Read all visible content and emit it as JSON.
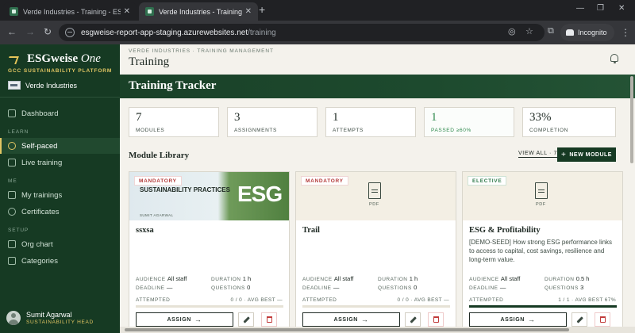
{
  "browser": {
    "tabs": [
      {
        "title": "Verde Industries - Training - ESG",
        "active": false
      },
      {
        "title": "Verde Industries - Training - ESG",
        "active": true
      }
    ],
    "url_host": "esgweise-report-app-staging.azurewebsites.net",
    "url_path": "/training",
    "incognito_label": "Incognito"
  },
  "sidebar": {
    "brand": "ESGweise",
    "brand_suffix": "One",
    "platform": "GCC SUSTAINABILITY PLATFORM",
    "org": "Verde Industries",
    "items": [
      {
        "label": "Dashboard",
        "icon": "grid-icon"
      },
      {
        "section": "LEARN"
      },
      {
        "label": "Self-paced",
        "icon": "play-circle-icon",
        "active": true
      },
      {
        "label": "Live training",
        "icon": "video-icon"
      },
      {
        "section": "ME"
      },
      {
        "label": "My trainings",
        "icon": "book-icon"
      },
      {
        "label": "Certificates",
        "icon": "award-icon"
      },
      {
        "section": "SETUP"
      },
      {
        "label": "Org chart",
        "icon": "users-icon"
      },
      {
        "label": "Categories",
        "icon": "tag-icon"
      }
    ],
    "user": {
      "name": "Sumit Agarwal",
      "role": "SUSTAINABILITY HEAD"
    }
  },
  "header": {
    "breadcrumb": "VERDE INDUSTRIES · TRAINING MANAGEMENT",
    "title": "Training"
  },
  "hero": {
    "title": "Training Tracker"
  },
  "stats": [
    {
      "value": "7",
      "label": "MODULES"
    },
    {
      "value": "3",
      "label": "ASSIGNMENTS"
    },
    {
      "value": "1",
      "label": "ATTEMPTS"
    },
    {
      "value": "1",
      "label": "PASSED ≥60%"
    },
    {
      "value": "33%",
      "label": "COMPLETION"
    }
  ],
  "library": {
    "title": "Module Library",
    "view_all": "VIEW ALL · 7",
    "new_module": "NEW MODULE"
  },
  "cards": [
    {
      "badge": "MANDATORY",
      "thumb_title": "SUSTAINABILITY PRACTICES",
      "thumb_author": "SUMIT AGARWAL",
      "thumb_word": "ESG",
      "title": "ssxsa",
      "description": "",
      "audience": "All staff",
      "duration": "1 h",
      "deadline": "—",
      "questions": "0",
      "attempted": "0 / 0 · AVG BEST —",
      "progress": 0,
      "assign": "ASSIGN"
    },
    {
      "badge": "MANDATORY",
      "pdf_label": "PDF",
      "title": "Trail",
      "description": "",
      "audience": "All staff",
      "duration": "1 h",
      "deadline": "—",
      "questions": "0",
      "attempted": "0 / 0 · AVG BEST —",
      "progress": 0,
      "assign": "ASSIGN"
    },
    {
      "badge": "ELECTIVE",
      "pdf_label": "PDF",
      "title": "ESG & Profitability",
      "description": "[DEMO-SEED] How strong ESG performance links to access to capital, cost savings, resilience and long-term value.",
      "audience": "All staff",
      "duration": "0.5 h",
      "deadline": "—",
      "questions": "3",
      "attempted": "1 / 1 · AVG BEST 67%",
      "progress": 1,
      "assign": "ASSIGN"
    }
  ],
  "labels": {
    "audience": "AUDIENCE",
    "duration": "DURATION",
    "deadline": "DEADLINE",
    "questions": "QUESTIONS",
    "attempted": "ATTEMPTED"
  }
}
